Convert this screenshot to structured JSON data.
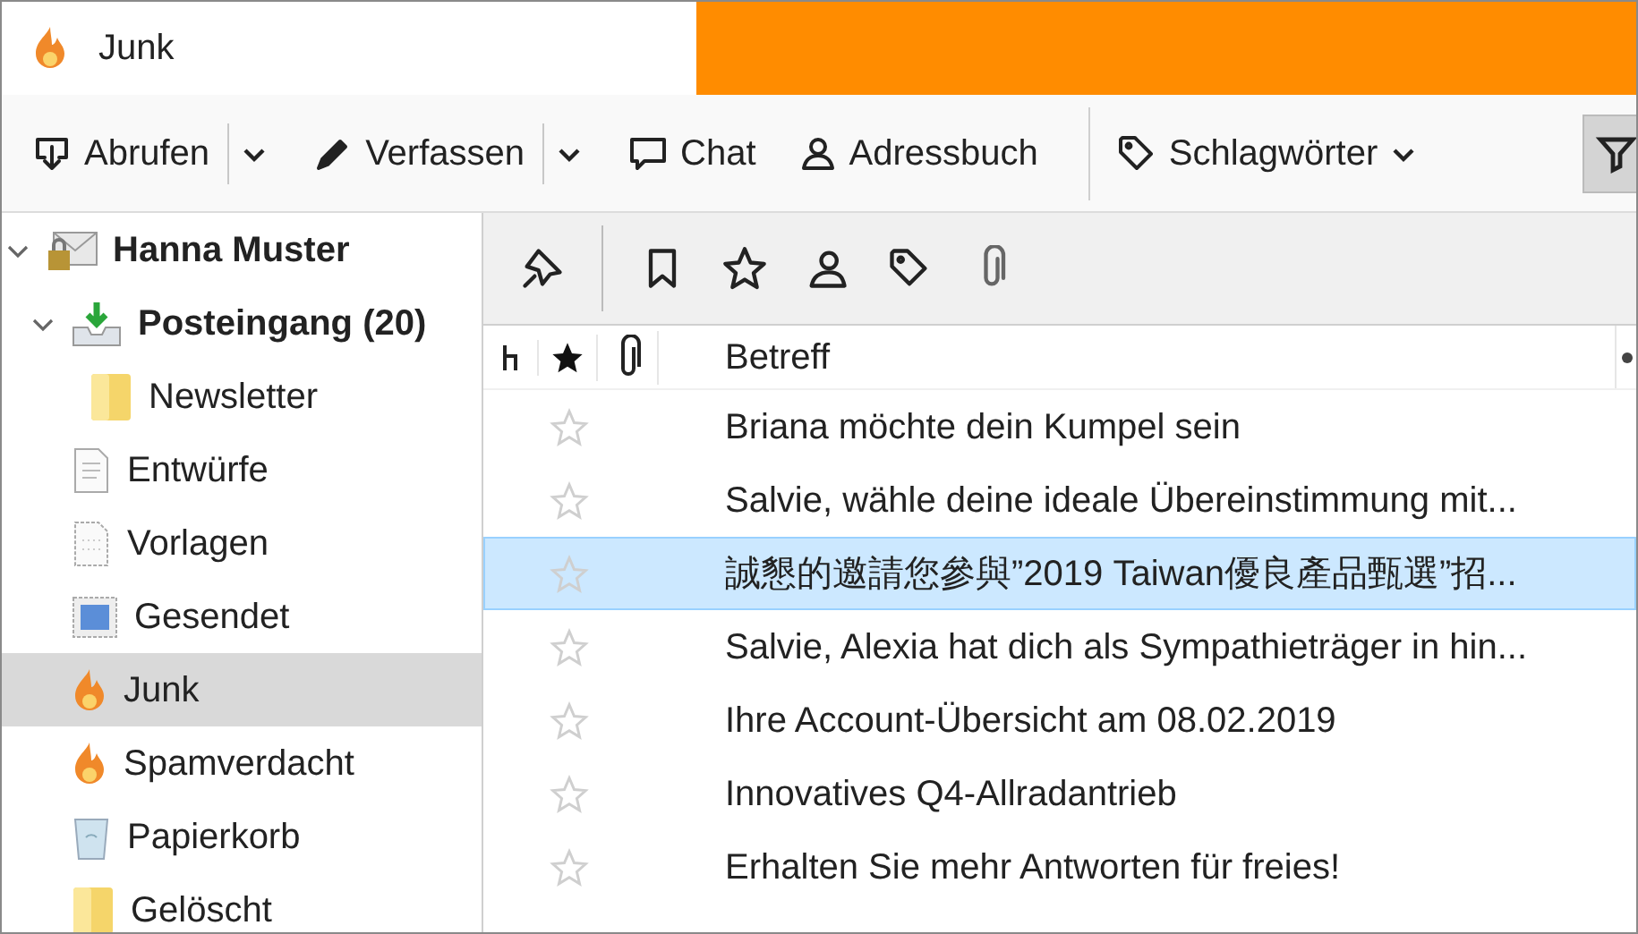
{
  "window": {
    "title": "Junk"
  },
  "toolbar": {
    "buttons": [
      {
        "kind": "get",
        "label": "Abrufen",
        "dropdown": true
      },
      {
        "kind": "write",
        "label": "Verfassen",
        "dropdown": true
      },
      {
        "kind": "chat",
        "label": "Chat",
        "dropdown": false
      },
      {
        "kind": "contacts",
        "label": "Adressbuch",
        "dropdown": false
      },
      {
        "kind": "tag",
        "label": "Schlagwörter",
        "dropdown": true
      }
    ]
  },
  "sidebar": {
    "items": [
      {
        "kind": "account",
        "label": "Hanna Muster",
        "bold": true,
        "expanded": true,
        "selected": false,
        "children": [
          {
            "kind": "inbox",
            "label": "Posteingang (20)",
            "bold": true,
            "expanded": true,
            "selected": false,
            "children": [
              {
                "kind": "folder",
                "label": "Newsletter",
                "bold": false,
                "selected": false
              }
            ]
          },
          {
            "kind": "drafts",
            "label": "Entwürfe",
            "bold": false,
            "selected": false
          },
          {
            "kind": "templates",
            "label": "Vorlagen",
            "bold": false,
            "selected": false
          },
          {
            "kind": "sent",
            "label": "Gesendet",
            "bold": false,
            "selected": false
          },
          {
            "kind": "junk",
            "label": "Junk",
            "bold": false,
            "selected": true
          },
          {
            "kind": "junk",
            "label": "Spamverdacht",
            "bold": false,
            "selected": false
          },
          {
            "kind": "trash",
            "label": "Papierkorb",
            "bold": false,
            "selected": false
          },
          {
            "kind": "folder",
            "label": "Gelöscht",
            "bold": false,
            "selected": false
          }
        ]
      }
    ]
  },
  "table": {
    "columns": [
      {
        "kind": "thread"
      },
      {
        "kind": "star"
      },
      {
        "kind": "attachment"
      },
      {
        "kind": "text",
        "label": "Betreff"
      }
    ],
    "rows": [
      {
        "subject": "Briana möchte dein Kumpel sein",
        "starred": false,
        "selected": false
      },
      {
        "subject": "Salvie, wähle deine ideale Übereinstimmung mit...",
        "starred": false,
        "selected": false
      },
      {
        "subject": "誠懇的邀請您參與”2019 Taiwan優良產品甄選”招...",
        "starred": false,
        "selected": true
      },
      {
        "subject": "Salvie, Alexia hat dich als Sympathieträger in hin...",
        "starred": false,
        "selected": false
      },
      {
        "subject": "Ihre Account-Übersicht am 08.02.2019",
        "starred": false,
        "selected": false
      },
      {
        "subject": "Innovatives Q4-Allradantrieb",
        "starred": false,
        "selected": false
      },
      {
        "subject": "Erhalten Sie mehr Antworten für freies!",
        "starred": false,
        "selected": false
      }
    ]
  }
}
